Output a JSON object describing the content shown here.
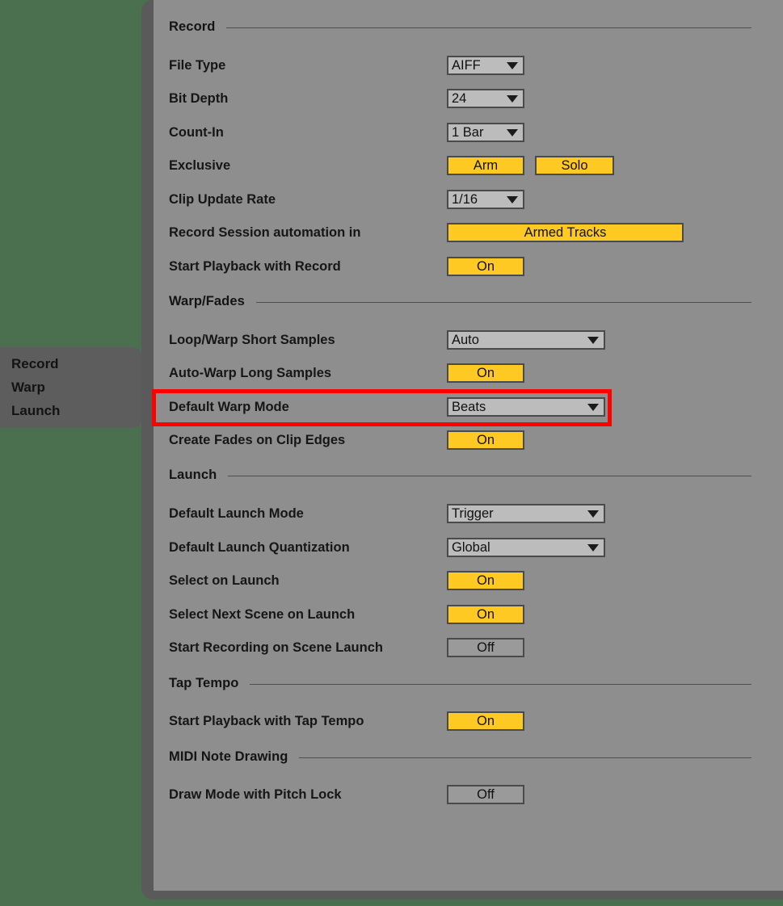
{
  "sidebar": {
    "items": [
      {
        "label": "Record"
      },
      {
        "label": "Warp"
      },
      {
        "label": "Launch"
      }
    ]
  },
  "colors": {
    "background": "#4a7050",
    "shell": "#5a5a5a",
    "panel": "#8e8e8e",
    "accent_yellow": "#ffc923",
    "dropdown_fill": "#bcbcbc",
    "highlight_red": "#ff0000",
    "text": "#161616"
  },
  "sections": {
    "record": {
      "title": "Record",
      "rows": {
        "file_type": {
          "label": "File Type",
          "value": "AIFF"
        },
        "bit_depth": {
          "label": "Bit Depth",
          "value": "24"
        },
        "count_in": {
          "label": "Count-In",
          "value": "1 Bar"
        },
        "exclusive": {
          "label": "Exclusive",
          "arm": "Arm",
          "solo": "Solo"
        },
        "clip_update_rate": {
          "label": "Clip Update Rate",
          "value": "1/16"
        },
        "record_session": {
          "label": "Record Session automation in",
          "value": "Armed Tracks"
        },
        "start_playback": {
          "label": "Start Playback with Record",
          "value": "On"
        }
      }
    },
    "warp_fades": {
      "title": "Warp/Fades",
      "rows": {
        "loop_warp_short": {
          "label": "Loop/Warp Short Samples",
          "value": "Auto"
        },
        "auto_warp_long": {
          "label": "Auto-Warp Long Samples",
          "value": "On"
        },
        "default_warp": {
          "label": "Default Warp Mode",
          "value": "Beats"
        },
        "create_fades": {
          "label": "Create Fades on Clip Edges",
          "value": "On"
        }
      }
    },
    "launch": {
      "title": "Launch",
      "rows": {
        "default_launch_mode": {
          "label": "Default Launch Mode",
          "value": "Trigger"
        },
        "default_launch_quant": {
          "label": "Default Launch Quantization",
          "value": "Global"
        },
        "select_on_launch": {
          "label": "Select on Launch",
          "value": "On"
        },
        "select_next_scene": {
          "label": "Select Next Scene on Launch",
          "value": "On"
        },
        "start_rec_scene": {
          "label": "Start Recording on Scene Launch",
          "value": "Off"
        }
      }
    },
    "tap_tempo": {
      "title": "Tap Tempo",
      "rows": {
        "start_playback_tap": {
          "label": "Start Playback with Tap Tempo",
          "value": "On"
        }
      }
    },
    "midi_note_drawing": {
      "title": "MIDI Note Drawing",
      "rows": {
        "draw_mode_pitch_lock": {
          "label": "Draw Mode with Pitch Lock",
          "value": "Off"
        }
      }
    }
  }
}
